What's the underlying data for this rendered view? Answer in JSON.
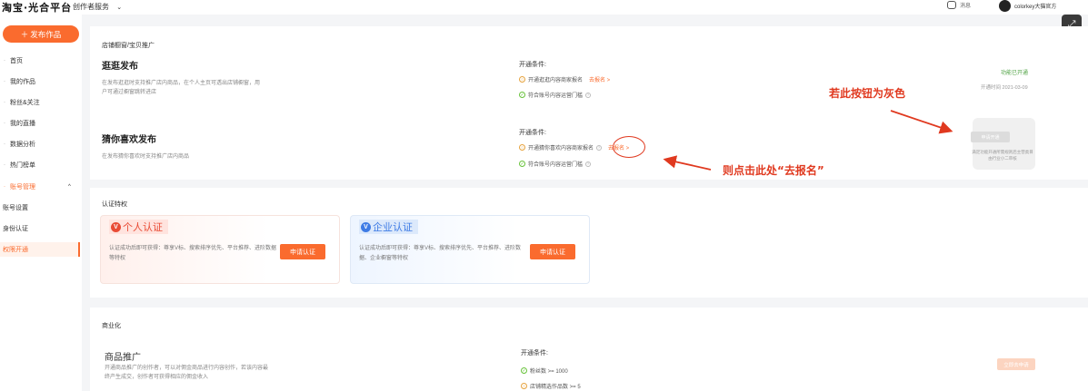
{
  "topbar": {
    "logo": "淘宝·光合平台",
    "nav": "创作者服务",
    "messages": "消息",
    "user_name": "colorkey大猫官方"
  },
  "sidebar": {
    "publish": "发布作品",
    "items": [
      {
        "label": "首页"
      },
      {
        "label": "我的作品"
      },
      {
        "label": "粉丝&关注"
      },
      {
        "label": "我的直播"
      },
      {
        "label": "数据分析"
      },
      {
        "label": "热门榜单"
      },
      {
        "label": "账号管理"
      },
      {
        "label": "账号设置"
      },
      {
        "label": "身份认证"
      },
      {
        "label": "权限开通"
      }
    ]
  },
  "promo": {
    "section_title": "店铺橱窗/宝贝推广",
    "row1": {
      "title": "逛逛发布",
      "desc": "在发布逛逛时支持推广店内商品，在个人主页可透出店铺橱窗，用户可通过橱窗跳转进店",
      "cond_label": "开通条件:",
      "cond1": "开通逛逛内容商家报名",
      "cond1_link": "去报名 >",
      "cond2": "符合账号内容运营门槛",
      "status": "功能已开通",
      "date": "开通时间 2021-03-09"
    },
    "row2": {
      "title": "猜你喜欢发布",
      "desc": "在发布猜你喜欢时支持推广店内商品",
      "cond_label": "开通条件:",
      "cond1": "开通猜你喜欢内容商家报名",
      "cond1_link": "去报名 >",
      "cond2": "符合账号内容运营门槛",
      "button": "申请开通",
      "note": "满足功能开通所需规则后主营类目由行业小二审核"
    }
  },
  "annotations": {
    "gray_hint": "若此按钮为灰色",
    "click_hint": "则点击此处“去报名”"
  },
  "cert": {
    "section_title": "认证特权",
    "personal": {
      "badge": "V",
      "title": "个人认证",
      "desc": "认证成功后即可获得：尊享V标、搜索排序优先、平台推荐、进阶数据等特权",
      "button": "申请认证"
    },
    "enterprise": {
      "badge": "V",
      "title": "企业认证",
      "desc": "认证成功后即可获得：尊享V标、搜索排序优先、平台推荐、进阶数据、企业橱窗等特权",
      "button": "申请认证"
    }
  },
  "biz": {
    "section_title": "商业化",
    "title": "商品推广",
    "desc": "开通商品推广的创作者，可以对佣金商品进行内容创作，若该内容最终产生成交，创作者可获得相应的佣金收入",
    "cond_label": "开通条件:",
    "cond1": "粉丝数 >= 1000",
    "cond2": "店铺精选作品数 >= 5",
    "button": "立即去申请"
  },
  "colors": {
    "accent": "#fa6b2e",
    "annotation": "#e0391f",
    "success": "#52a447"
  }
}
